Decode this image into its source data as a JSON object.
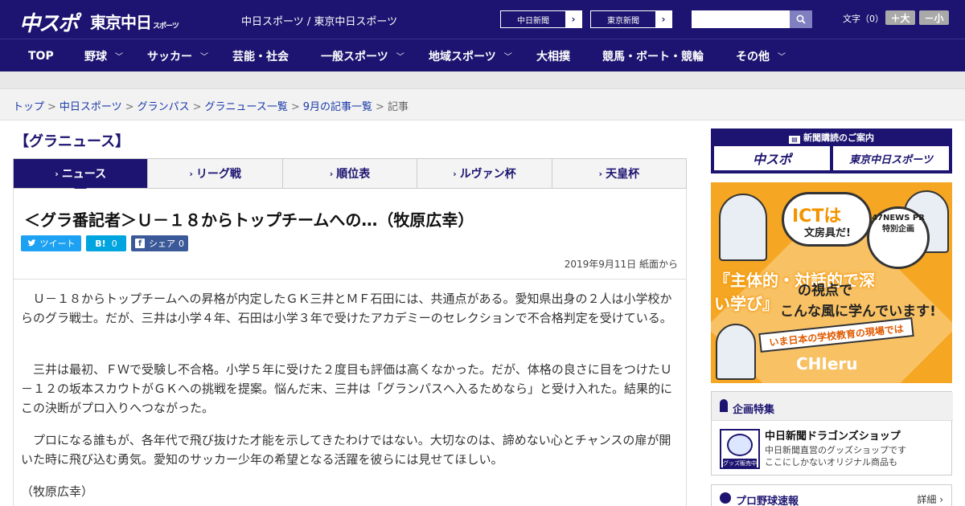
{
  "header": {
    "logo_main": "中スポ",
    "logo_tokyo": "東京中日",
    "logo_tokyo_sub": "スポーツ",
    "site_links": "中日スポーツ / 東京中日スポーツ",
    "paper_buttons": [
      "中日新聞",
      "東京新聞"
    ],
    "font_size_label": "文字（0）",
    "font_plus": "＋大",
    "font_minus": "－小"
  },
  "nav": {
    "items": [
      {
        "label": "TOP",
        "has_dropdown": false
      },
      {
        "label": "野球",
        "has_dropdown": true
      },
      {
        "label": "サッカー",
        "has_dropdown": true
      },
      {
        "label": "芸能・社会",
        "has_dropdown": false
      },
      {
        "label": "一般スポーツ",
        "has_dropdown": true
      },
      {
        "label": "地域スポーツ",
        "has_dropdown": true
      },
      {
        "label": "大相撲",
        "has_dropdown": false
      },
      {
        "label": "競馬・ボート・競輪",
        "has_dropdown": false
      },
      {
        "label": "その他",
        "has_dropdown": true
      }
    ]
  },
  "breadcrumb": {
    "links": [
      "トップ",
      "中日スポーツ",
      "グランパス",
      "グラニュース一覧",
      "9月の記事一覧"
    ],
    "current": "記事",
    "separator": ">"
  },
  "section": {
    "title": "【グラニュース】"
  },
  "tabs": [
    {
      "label": "ニュース",
      "active": true
    },
    {
      "label": "リーグ戦",
      "active": false
    },
    {
      "label": "順位表",
      "active": false
    },
    {
      "label": "ルヴァン杯",
      "active": false
    },
    {
      "label": "天皇杯",
      "active": false
    }
  ],
  "article": {
    "title": "＜グラ番記者＞Ｕ－１８からトップチームへの…（牧原広幸）",
    "share": {
      "tweet": "ツイート",
      "hatena_label": "B!",
      "hatena_count": "0",
      "facebook": "シェア",
      "facebook_count": "0"
    },
    "date": "2019年9月11日 紙面から",
    "paragraphs": [
      "　Ｕ－１８からトップチームへの昇格が内定したＧＫ三井とＭＦ石田には、共通点がある。愛知県出身の２人は小学校からのグラ戦士。だが、三井は小学４年、石田は小学３年で受けたアカデミーのセレクションで不合格判定を受けている。",
      "　三井は最初、ＦＷで受験し不合格。小学５年に受けた２度目も評価は高くなかった。だが、体格の良さに目をつけたＵ－１２の坂本スカウトがＧＫへの挑戦を提案。悩んだ末、三井は「グランパスへ入るためなら」と受け入れた。結果的にこの決断がプロ入りへつながった。",
      "　プロになる誰もが、各年代で飛び抜けた才能を示してきたわけではない。大切なのは、諦めない心とチャンスの扉が開いた時に飛び込む勇気。愛知のサッカー少年の希望となる活躍を彼らには見せてほしい。",
      "（牧原広幸）"
    ]
  },
  "sidebar": {
    "subscription": {
      "title": "新聞購読のご案内",
      "buttons": [
        "中スポ",
        "東京中日スポーツ"
      ]
    },
    "promo": {
      "ict": "ICTは",
      "ict_sub": "文房具だ!",
      "badge": "47NEWS PR 特別企画",
      "line1": "『主体的・対話的で深い学び』",
      "line2": "の視点で",
      "line3": "こんな風に学んでいます!",
      "banner": "いま日本の学校教育の現場では",
      "brand": "CHIeru"
    },
    "feature": {
      "title": "企画特集",
      "shop_badge": "グッズ販売中",
      "shop_title": "中日新聞ドラゴンズショップ",
      "shop_desc1": "中日新聞直営のグッズショップです",
      "shop_desc2": "ここにしかないオリジナル商品も"
    },
    "baseball": {
      "title": "プロ野球速報",
      "more": "詳細 ›"
    }
  },
  "colors": {
    "brand_navy": "#1c1470",
    "twitter": "#1da1f2",
    "hatena": "#00a4de",
    "facebook": "#3b5998",
    "promo_orange": "#f5a623"
  }
}
